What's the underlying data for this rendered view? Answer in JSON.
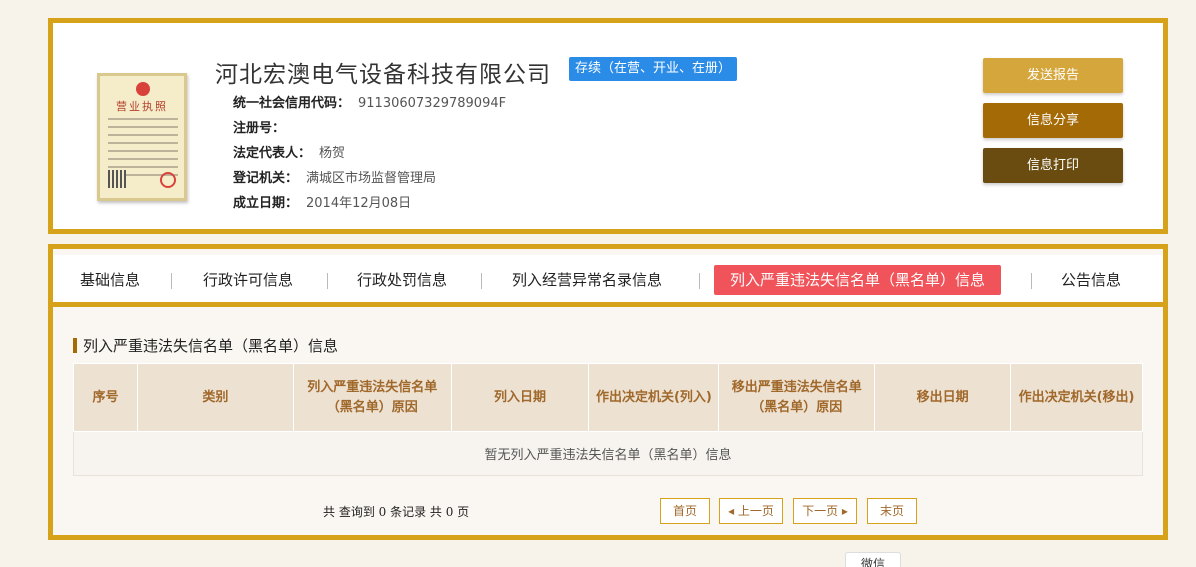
{
  "company": {
    "name": "河北宏澳电气设备科技有限公司",
    "status": "存续（在营、开业、在册）",
    "license_title": "营业执照",
    "info": [
      {
        "label": "统一社会信用代码：",
        "value": "91130607329789094F"
      },
      {
        "label": "注册号：",
        "value": ""
      },
      {
        "label": "法定代表人：",
        "value": "杨贺"
      },
      {
        "label": "登记机关：",
        "value": "满城区市场监督管理局"
      },
      {
        "label": "成立日期：",
        "value": "2014年12月08日"
      }
    ]
  },
  "actions": {
    "send_report": "发送报告",
    "share": "信息分享",
    "print": "信息打印"
  },
  "tabs": [
    {
      "label": "基础信息"
    },
    {
      "label": "行政许可信息"
    },
    {
      "label": "行政处罚信息"
    },
    {
      "label": "列入经营异常名录信息"
    },
    {
      "label": "列入严重违法失信名单（黑名单）信息",
      "active": true
    },
    {
      "label": "公告信息"
    }
  ],
  "section": {
    "title": "列入严重违法失信名单（黑名单）信息",
    "columns": [
      "序号",
      "类别",
      "列入严重违法失信名单（黑名单）原因",
      "列入日期",
      "作出决定机关(列入)",
      "移出严重违法失信名单（黑名单）原因",
      "移出日期",
      "作出决定机关(移出)"
    ],
    "empty_text": "暂无列入严重违法失信名单（黑名单）信息"
  },
  "pager": {
    "summary": "共 查询到 0 条记录 共 0 页",
    "first": "首页",
    "prev": "上一页",
    "next": "下一页",
    "last": "末页"
  },
  "floating": {
    "wechat": "微信"
  },
  "colors": {
    "border_gold": "#d6a219",
    "status_blue": "#2b8ce8",
    "tab_active": "#f0545a",
    "btn_send": "#d5a63b",
    "btn_share": "#a46a06",
    "btn_print": "#6b4c10"
  }
}
